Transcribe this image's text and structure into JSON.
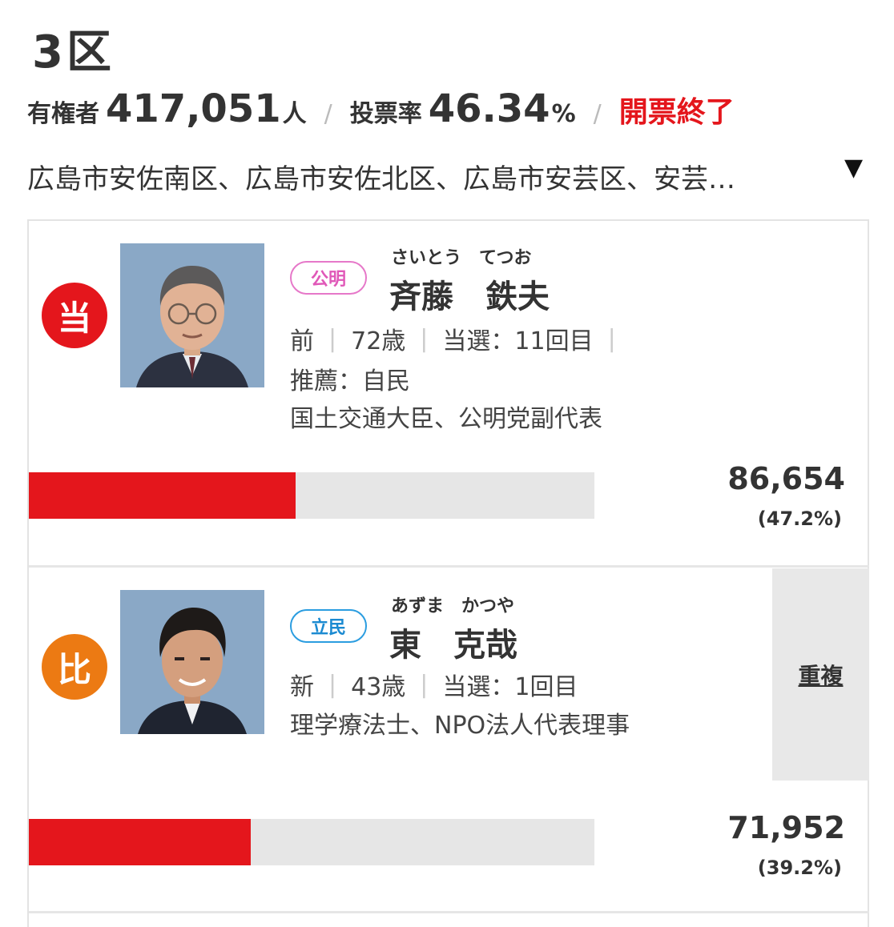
{
  "district": {
    "title": "3区"
  },
  "stats": {
    "electorate_label": "有権者",
    "electorate_value": "417,051",
    "electorate_unit": "人",
    "turnout_label": "投票率",
    "turnout_value": "46.34",
    "turnout_unit": "%",
    "status": "開票終了",
    "separator": "/"
  },
  "areas": {
    "text": "広島市安佐南区、広島市安佐北区、広島市安芸区、安芸…",
    "toggle": "▼"
  },
  "candidates": [
    {
      "badge": "当",
      "party": "公明",
      "kana": "さいとう　てつお",
      "name": "斉藤　鉄夫",
      "status": "前",
      "age": "72歳",
      "elected_count": "当選：11回目",
      "recommend": "推薦：自民",
      "career": "国土交通大臣、公明党副代表",
      "votes": "86,654",
      "percent": "(47.2%)",
      "share": 0.472
    },
    {
      "badge": "比",
      "party": "立民",
      "kana": "あずま　かつや",
      "name": "東　克哉",
      "status": "新",
      "age": "43歳",
      "elected_count": "当選：1回目",
      "career": "理学療法士、NPO法人代表理事",
      "duplicate": "重複",
      "votes": "71,952",
      "percent": "(39.2%)",
      "share": 0.392
    }
  ],
  "colors": {
    "win": "#e4161c",
    "proportional": "#ec7a13",
    "komei": "#e058b8",
    "rikken": "#1b8ad1",
    "bar": "#e4161c"
  }
}
